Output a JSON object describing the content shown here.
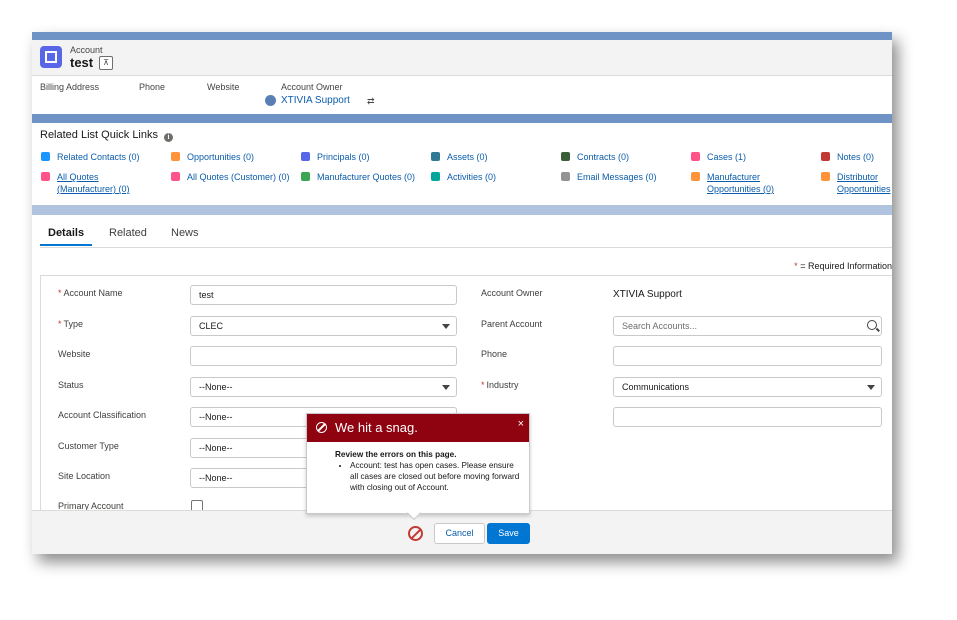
{
  "header": {
    "object_label": "Account",
    "record_title": "test",
    "hierarchy_icon": "hierarchy-icon"
  },
  "highlights": {
    "billing_address_label": "Billing Address",
    "phone_label": "Phone",
    "website_label": "Website",
    "account_owner_label": "Account Owner",
    "account_owner_value": "XTIVIA Support"
  },
  "related_list": {
    "title": "Related List Quick Links",
    "links": [
      {
        "label": "Related Contacts (0)",
        "color": "#1b96ff"
      },
      {
        "label": "Opportunities (0)",
        "color": "#fe9339"
      },
      {
        "label": "Principals (0)",
        "color": "#5867e8"
      },
      {
        "label": "Assets (0)",
        "color": "#317992"
      },
      {
        "label": "Contracts (0)",
        "color": "#3b5e3a"
      },
      {
        "label": "Cases (1)",
        "color": "#ff538a"
      },
      {
        "label": "Notes (0)",
        "color": "#c23934"
      },
      {
        "label": "All Quotes (Manufacturer) (0)",
        "color": "#ff538a"
      },
      {
        "label": "All Quotes (Customer) (0)",
        "color": "#ff538a"
      },
      {
        "label": "Manufacturer Quotes (0)",
        "color": "#3ba755"
      },
      {
        "label": "Activities (0)",
        "color": "#06a59a"
      },
      {
        "label": "Email Messages (0)",
        "color": "#939393"
      },
      {
        "label": "Manufacturer Opportunities (0)",
        "color": "#fe9339"
      },
      {
        "label": "Distributor Opportunities",
        "color": "#fe9339"
      }
    ]
  },
  "tabs": [
    "Details",
    "Related",
    "News"
  ],
  "required_info": "= Required Information",
  "form": {
    "account_name_label": "Account Name",
    "account_name_value": "test",
    "type_label": "Type",
    "type_value": "CLEC",
    "website_label": "Website",
    "status_label": "Status",
    "status_value": "--None--",
    "classification_label": "Account Classification",
    "classification_value": "--None--",
    "customer_type_label": "Customer Type",
    "customer_type_value": "--None--",
    "site_location_label": "Site Location",
    "site_location_value": "--None--",
    "primary_account_label": "Primary Account",
    "account_owner_label": "Account Owner",
    "account_owner_value": "XTIVIA Support",
    "parent_account_label": "Parent Account",
    "parent_account_placeholder": "Search Accounts...",
    "phone_label": "Phone",
    "industry_label": "Industry",
    "industry_value": "Communications"
  },
  "footer": {
    "cancel_label": "Cancel",
    "save_label": "Save"
  },
  "error_popover": {
    "title": "We hit a snag.",
    "heading": "Review the errors on this page.",
    "message": "Account: test has open cases. Please ensure all cases are closed out before moving forward with closing out of Account.",
    "close_symbol": "×"
  }
}
